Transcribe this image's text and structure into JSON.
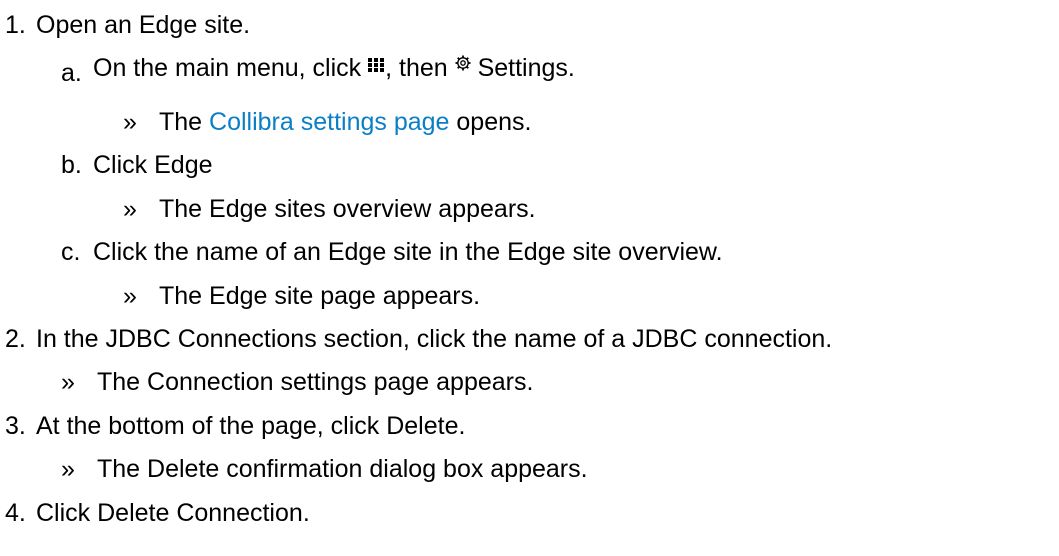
{
  "steps": [
    {
      "num": "1.",
      "text": "Open an Edge site."
    },
    {
      "num": "2.",
      "text": "In the JDBC Connections section, click the name of a JDBC connection."
    },
    {
      "num": "3.",
      "pre": "At the bottom of the page, click ",
      "bold": "Delete",
      "post": "."
    },
    {
      "num": "4.",
      "pre": "Click ",
      "bold": "Delete Connection",
      "post": "."
    }
  ],
  "substeps": [
    {
      "letter": "a.",
      "pre": "On the main menu, click ",
      "mid": ", then ",
      "bold": "Settings",
      "post": "."
    },
    {
      "letter": "b.",
      "pre": "Click ",
      "bold": "Edge"
    },
    {
      "letter": "c.",
      "text": "Click the name of an Edge site in the Edge site overview."
    }
  ],
  "results": {
    "a": {
      "mark": "»",
      "pre": "The ",
      "link": "Collibra settings page",
      "post": " opens."
    },
    "b": {
      "mark": "»",
      "text": "The Edge sites overview appears."
    },
    "c": {
      "mark": "»",
      "text": "The Edge site page appears."
    },
    "s2": {
      "mark": "»",
      "pre": "The ",
      "bold": "Connection settings",
      "post": " page appears."
    },
    "s3": {
      "mark": "»",
      "pre": "The ",
      "bold": "Delete confirmation",
      "post": " dialog box appears."
    }
  },
  "icons": [
    "apps-grid-icon",
    "settings-gear-icon"
  ],
  "colors": {
    "link": "#0a7fc8",
    "text": "#000000"
  }
}
